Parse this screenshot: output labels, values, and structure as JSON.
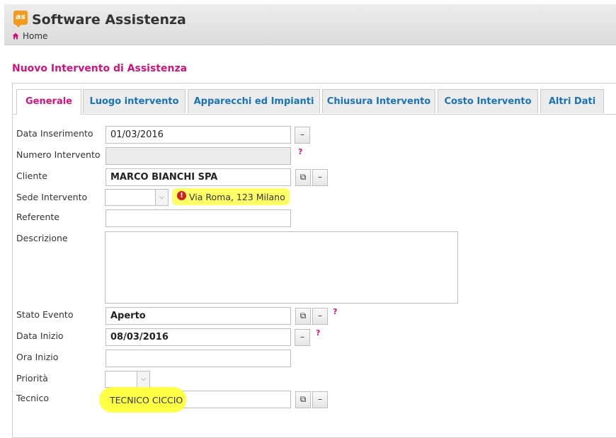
{
  "app": {
    "logo_text": "as",
    "title": "Software Assistenza"
  },
  "breadcrumb": {
    "home_label": "Home"
  },
  "page": {
    "title": "Nuovo Intervento di Assistenza"
  },
  "tabs": [
    {
      "label": "Generale",
      "active": true
    },
    {
      "label": "Luogo intervento",
      "active": false
    },
    {
      "label": "Apparecchi ed Impianti",
      "active": false
    },
    {
      "label": "Chiusura Intervento",
      "active": false
    },
    {
      "label": "Costo Intervento",
      "active": false
    },
    {
      "label": "Altri Dati",
      "active": false
    }
  ],
  "form": {
    "data_inserimento": {
      "label": "Data Inserimento",
      "value": "01/03/2016"
    },
    "numero_intervento": {
      "label": "Numero Intervento",
      "value": "",
      "help": "?"
    },
    "cliente": {
      "label": "Cliente",
      "value": "MARCO BIANCHI SPA"
    },
    "sede_intervento": {
      "label": "Sede Intervento",
      "value": "",
      "note": "Via Roma, 123 Milano",
      "note_icon": "exclamation-circle-icon"
    },
    "referente": {
      "label": "Referente",
      "value": ""
    },
    "descrizione": {
      "label": "Descrizione",
      "value": ""
    },
    "stato_evento": {
      "label": "Stato Evento",
      "value": "Aperto",
      "help": "?"
    },
    "data_inizio": {
      "label": "Data Inizio",
      "value": "08/03/2016",
      "help": "?"
    },
    "ora_inizio": {
      "label": "Ora Inizio",
      "value": ""
    },
    "priorita": {
      "label": "Priorità",
      "value": ""
    },
    "tecnico": {
      "label": "Tecnico",
      "value": "TECNICO CICCIO"
    }
  },
  "buttons": {
    "clear": "–",
    "lookup": "⧉"
  },
  "colors": {
    "accent": "#d4127d",
    "tab_text": "#1a73b8",
    "logo": "#f39a1d",
    "highlight": "#ffff66"
  }
}
